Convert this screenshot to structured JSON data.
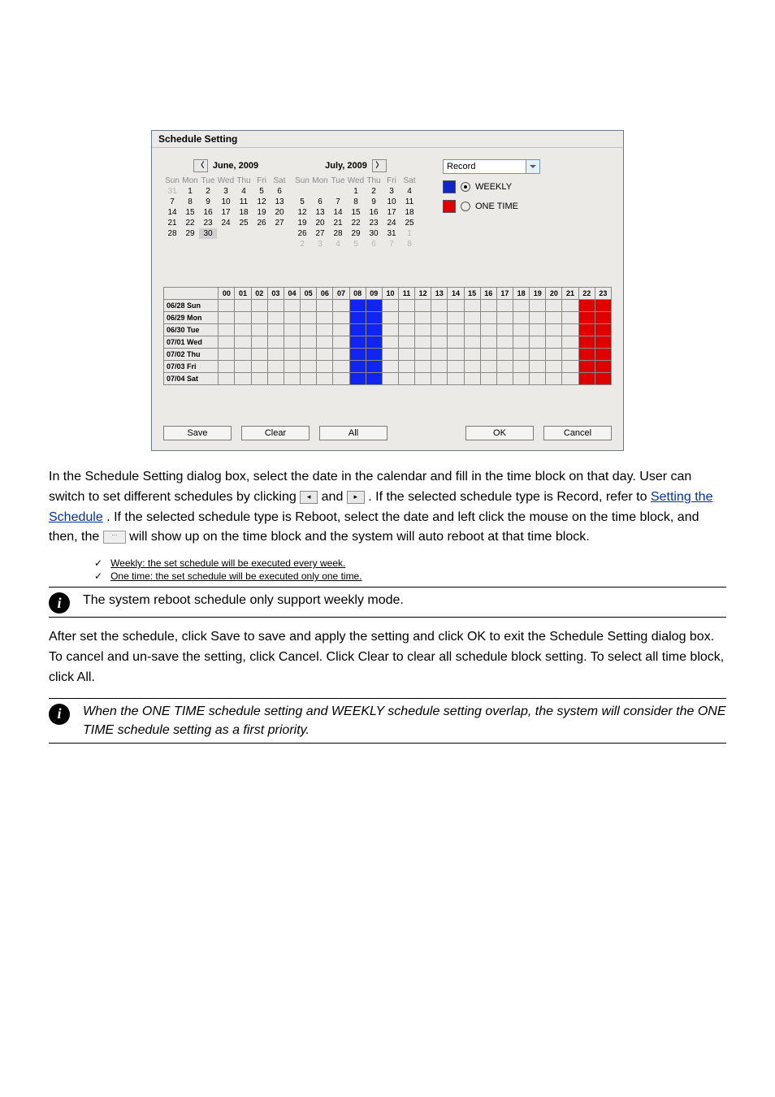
{
  "dialog": {
    "title": "Schedule Setting",
    "monthLeft": "June, 2009",
    "monthRight": "July, 2009",
    "dow": [
      "Sun",
      "Mon",
      "Tue",
      "Wed",
      "Thu",
      "Fri",
      "Sat"
    ],
    "juneDays": [
      {
        "d": "31",
        "o": true
      },
      {
        "d": "1"
      },
      {
        "d": "2"
      },
      {
        "d": "3"
      },
      {
        "d": "4"
      },
      {
        "d": "5"
      },
      {
        "d": "6"
      },
      {
        "d": "7"
      },
      {
        "d": "8"
      },
      {
        "d": "9"
      },
      {
        "d": "10"
      },
      {
        "d": "11"
      },
      {
        "d": "12"
      },
      {
        "d": "13"
      },
      {
        "d": "14"
      },
      {
        "d": "15"
      },
      {
        "d": "16"
      },
      {
        "d": "17"
      },
      {
        "d": "18"
      },
      {
        "d": "19"
      },
      {
        "d": "20"
      },
      {
        "d": "21"
      },
      {
        "d": "22"
      },
      {
        "d": "23"
      },
      {
        "d": "24"
      },
      {
        "d": "25"
      },
      {
        "d": "26"
      },
      {
        "d": "27"
      },
      {
        "d": "28"
      },
      {
        "d": "29"
      },
      {
        "d": "30",
        "sel": true
      }
    ],
    "julyDays": [
      {
        "d": ""
      },
      {
        "d": ""
      },
      {
        "d": ""
      },
      {
        "d": "1"
      },
      {
        "d": "2"
      },
      {
        "d": "3"
      },
      {
        "d": "4"
      },
      {
        "d": "5"
      },
      {
        "d": "6"
      },
      {
        "d": "7"
      },
      {
        "d": "8"
      },
      {
        "d": "9"
      },
      {
        "d": "10"
      },
      {
        "d": "11"
      },
      {
        "d": "12"
      },
      {
        "d": "13"
      },
      {
        "d": "14"
      },
      {
        "d": "15"
      },
      {
        "d": "16"
      },
      {
        "d": "17"
      },
      {
        "d": "18"
      },
      {
        "d": "19"
      },
      {
        "d": "20"
      },
      {
        "d": "21"
      },
      {
        "d": "22"
      },
      {
        "d": "23"
      },
      {
        "d": "24"
      },
      {
        "d": "25"
      },
      {
        "d": "26"
      },
      {
        "d": "27"
      },
      {
        "d": "28"
      },
      {
        "d": "29"
      },
      {
        "d": "30"
      },
      {
        "d": "31"
      },
      {
        "d": "1",
        "o": true
      },
      {
        "d": "2",
        "o": true
      },
      {
        "d": "3",
        "o": true
      },
      {
        "d": "4",
        "o": true
      },
      {
        "d": "5",
        "o": true
      },
      {
        "d": "6",
        "o": true
      },
      {
        "d": "7",
        "o": true
      },
      {
        "d": "8",
        "o": true
      }
    ],
    "comboValue": "Record",
    "legendWeekly": "WEEKLY",
    "legendOneTime": "ONE TIME",
    "hours": [
      "00",
      "01",
      "02",
      "03",
      "04",
      "05",
      "06",
      "07",
      "08",
      "09",
      "10",
      "11",
      "12",
      "13",
      "14",
      "15",
      "16",
      "17",
      "18",
      "19",
      "20",
      "21",
      "22",
      "23"
    ],
    "rows": [
      "06/28 Sun",
      "06/29 Mon",
      "06/30 Tue",
      "07/01 Wed",
      "07/02 Thu",
      "07/03 Fri",
      "07/04 Sat"
    ],
    "btnSave": "Save",
    "btnClear": "Clear",
    "btnAll": "All",
    "btnOk": "OK",
    "btnCancel": "Cancel"
  },
  "para1_a": "In the Schedule Setting dialog box, select the date in the calendar and fill in the time block on that day. User can switch to set different schedules by clicking ",
  "para1_b": " and ",
  "para1_c": ". If the selected schedule type is Record, refer to ",
  "para1_d": "Setting the Schedule",
  "para1_e": ". If the selected schedule type is Reboot, select the date and left click the mouse on the time block, and then, the ",
  "para1_f": " will show up on the time block and the system will auto reboot at that time block.",
  "list1": "Weekly: the set schedule will be executed every week.",
  "list2": "One time: the set schedule will be executed only one time.",
  "note1": "The system reboot schedule only support weekly mode.",
  "para2": "After set the schedule, click Save to save and apply the setting and click OK to exit the Schedule Setting dialog box. To cancel and un-save the setting, click Cancel. Click Clear to clear all schedule block setting. To select all time block, click All.",
  "note2": "When the ONE TIME schedule setting and WEEKLY schedule setting overlap, the system will consider the ONE TIME schedule setting as a first priority."
}
